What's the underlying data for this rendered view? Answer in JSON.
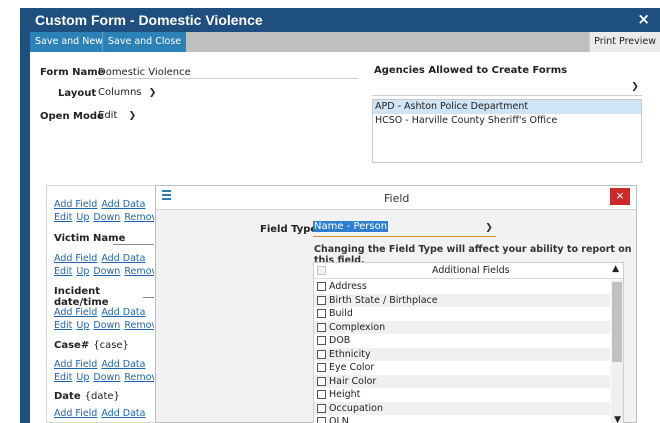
{
  "window": {
    "title": "Custom Form - Domestic Violence",
    "close_icon": "×"
  },
  "toolbar": {
    "save_new": "Save and New",
    "save_close": "Save and Close",
    "print_preview": "Print Preview"
  },
  "form": {
    "form_name_label": "Form Name",
    "form_name_value": "Domestic Violence",
    "layout_label": "Layout",
    "layout_value": "Columns",
    "open_mode_label": "Open Mode",
    "open_mode_value": "Edit"
  },
  "agencies": {
    "label": "Agencies Allowed to Create Forms",
    "items": [
      "APD - Ashton Police Department",
      "HCSO - Harville County Sheriff's Office"
    ]
  },
  "left_panel": {
    "links_row1": [
      "Add Field",
      "Add Data"
    ],
    "links_row2": [
      "Edit",
      "Up",
      "Down",
      "Remove"
    ],
    "fields": [
      {
        "name": "Victim Name",
        "token": ""
      },
      {
        "name": "Incident date/time",
        "token": ""
      },
      {
        "name": "Case#",
        "token": "{case}"
      },
      {
        "name": "Date",
        "token": "{date}"
      }
    ]
  },
  "dialog": {
    "title": "Field",
    "close_icon": "×",
    "field_type_label": "Field Type",
    "field_type_value": "Name - Person",
    "warning": "Changing the Field Type will affect your ability to report on this field.",
    "additional_fields_header": "Additional Fields",
    "additional_fields": [
      "Address",
      "Birth State / Birthplace",
      "Build",
      "Complexion",
      "DOB",
      "Ethnicity",
      "Eye Color",
      "Hair Color",
      "Height",
      "Occupation",
      "OLN"
    ]
  }
}
